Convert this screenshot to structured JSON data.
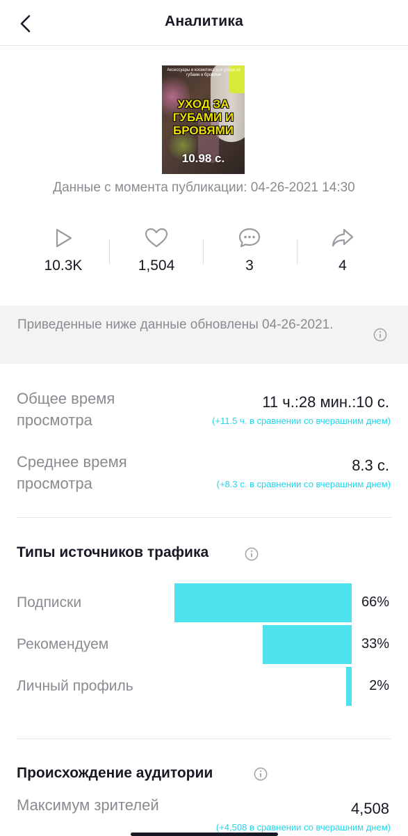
{
  "header": {
    "title": "Аналитика"
  },
  "video": {
    "thumbnail_small_text": "Аксессуары и косметика для ухода за губами и бровями",
    "thumbnail_big_text": "УХОД ЗА ГУБАМИ И БРОВЯМИ",
    "duration": "10.98 с.",
    "published_label": "Данные с момента публикации: 04-26-2021 14:30"
  },
  "stats": [
    {
      "icon": "play-icon",
      "value": "10.3K"
    },
    {
      "icon": "heart-icon",
      "value": "1,504"
    },
    {
      "icon": "comment-icon",
      "value": "3"
    },
    {
      "icon": "share-icon",
      "value": "4"
    }
  ],
  "notice": {
    "text": "Приведенные ниже данные обновлены 04-26-2021."
  },
  "metrics": [
    {
      "label": "Общее время просмотра",
      "value": "11 ч.:28 мин.:10 с.",
      "delta": "(+11.5 ч. в сравнении со вчерашним днем)"
    },
    {
      "label": "Среднее время просмотра",
      "value": "8.3 с.",
      "delta": "(+8.3 с. в сравнении со вчерашним днем)"
    }
  ],
  "traffic": {
    "title": "Типы источников трафика",
    "rows": [
      {
        "label": "Подписки",
        "percent_text": "66%",
        "fraction": 0.66
      },
      {
        "label": "Рекомендуем",
        "percent_text": "33%",
        "fraction": 0.33
      },
      {
        "label": "Личный профиль",
        "percent_text": "2%",
        "fraction": 0.02
      }
    ]
  },
  "audience": {
    "title": "Происхождение аудитории",
    "metric": {
      "label": "Максимум зрителей",
      "value": "4,508",
      "delta": "(+4,508 в сравнении со вчерашним днем)"
    }
  },
  "colors": {
    "accent": "#20d5ec",
    "bar": "#4ee1ee",
    "muted_text": "#8a8b91",
    "text": "#161823",
    "notice_bg": "#f3f3f4"
  }
}
